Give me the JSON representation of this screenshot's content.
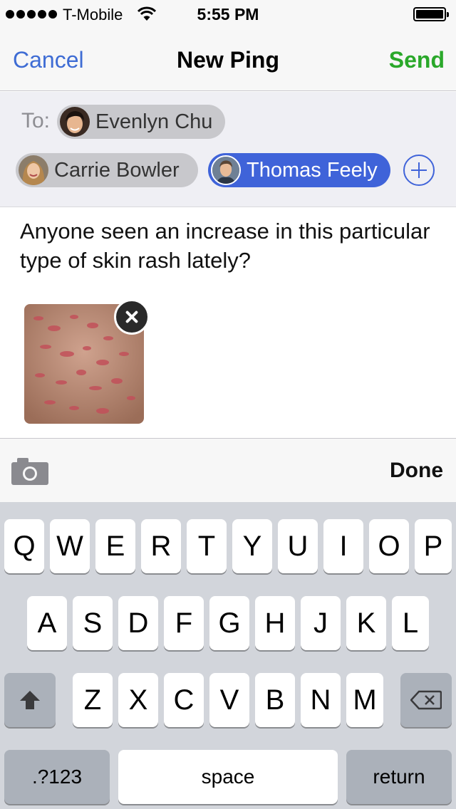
{
  "status_bar": {
    "carrier": "T-Mobile",
    "time": "5:55 PM"
  },
  "nav": {
    "cancel_label": "Cancel",
    "title": "New Ping",
    "send_label": "Send"
  },
  "recipients": {
    "to_label": "To:",
    "items": [
      {
        "name": "Evenlyn Chu",
        "selected": false
      },
      {
        "name": "Carrie Bowler",
        "selected": false
      },
      {
        "name": "Thomas Feely",
        "selected": true
      }
    ]
  },
  "message": {
    "text": "Anyone seen an increase in this particular type of skin rash lately?"
  },
  "toolbar": {
    "done_label": "Done"
  },
  "keyboard": {
    "row1": [
      "Q",
      "W",
      "E",
      "R",
      "T",
      "Y",
      "U",
      "I",
      "O",
      "P"
    ],
    "row2": [
      "A",
      "S",
      "D",
      "F",
      "G",
      "H",
      "J",
      "K",
      "L"
    ],
    "row3": [
      "Z",
      "X",
      "C",
      "V",
      "B",
      "N",
      "M"
    ],
    "numbers_label": ".?123",
    "space_label": "space",
    "return_label": "return"
  },
  "colors": {
    "accent_blue": "#3e6cd4",
    "send_green": "#2aa82a",
    "selected_chip": "#3f63d9"
  },
  "icons": [
    "wifi-icon",
    "battery-icon",
    "add-icon",
    "close-icon",
    "camera-icon",
    "shift-icon",
    "delete-icon"
  ]
}
